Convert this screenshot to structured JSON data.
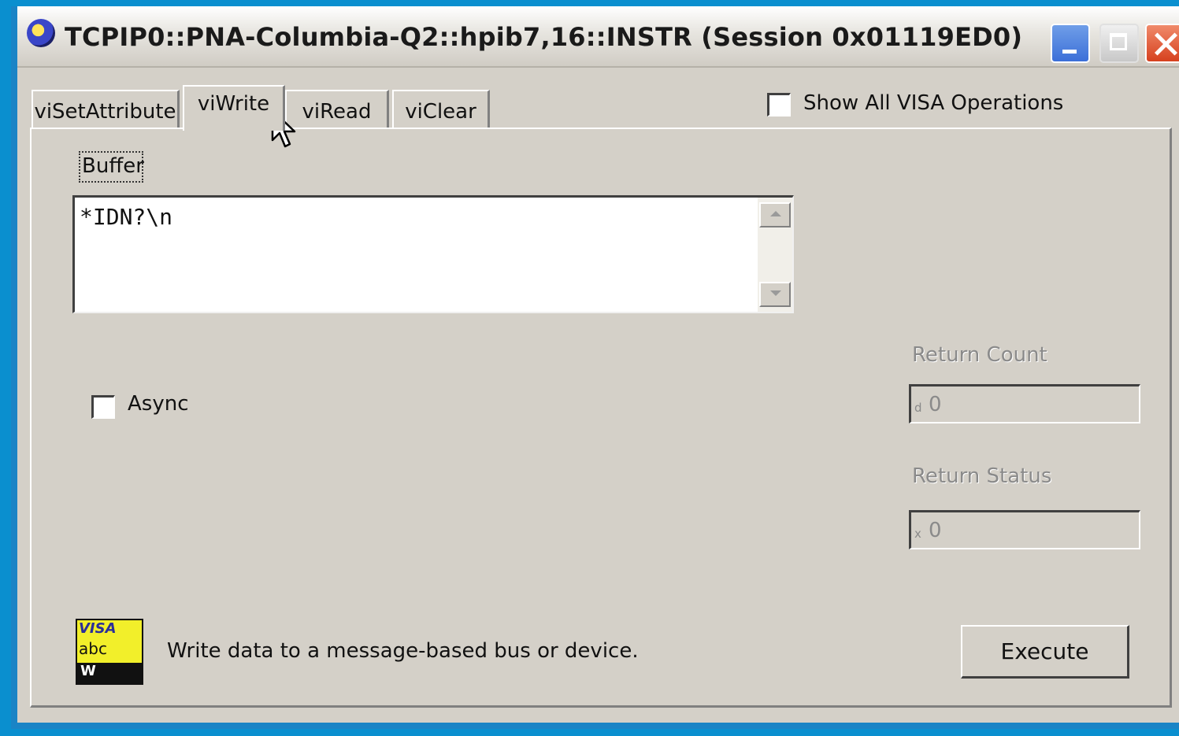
{
  "window": {
    "title": "TCPIP0::PNA-Columbia-Q2::hpib7,16::INSTR (Session 0x01119ED0)"
  },
  "tabs": [
    {
      "label": "viSetAttribute"
    },
    {
      "label": "viWrite",
      "selected": true
    },
    {
      "label": "viRead"
    },
    {
      "label": "viClear"
    }
  ],
  "options": {
    "show_all_label": "Show All VISA Operations",
    "show_all_checked": false,
    "async_label": "Async",
    "async_checked": false
  },
  "buffer": {
    "label": "Buffer",
    "value": "*IDN?\\n"
  },
  "return_count": {
    "label": "Return Count",
    "prefix": "d",
    "value": "0"
  },
  "return_status": {
    "label": "Return Status",
    "prefix": "x",
    "value": "0"
  },
  "footer": {
    "icon_line1": "VISA",
    "icon_line2": "abc",
    "icon_line3": "W",
    "description": "Write data to a message-based bus or device.",
    "execute_label": "Execute"
  }
}
